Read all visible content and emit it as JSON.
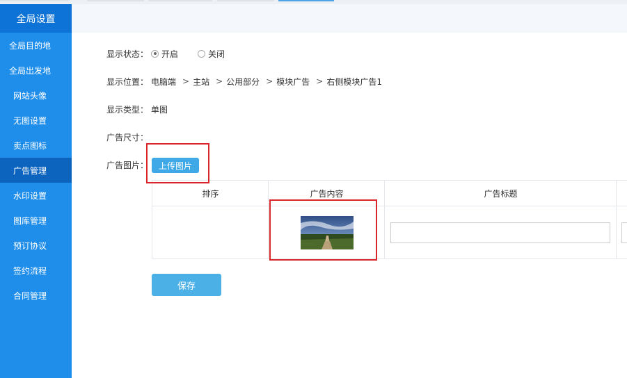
{
  "sidebar": {
    "header": "全局设置",
    "items": [
      {
        "label": "全局目的地"
      },
      {
        "label": "全局出发地"
      },
      {
        "label": "网站头像"
      },
      {
        "label": "无图设置"
      },
      {
        "label": "卖点图标"
      },
      {
        "label": "广告管理"
      },
      {
        "label": "水印设置"
      },
      {
        "label": "图库管理"
      },
      {
        "label": "预订协议"
      },
      {
        "label": "签约流程"
      },
      {
        "label": "合同管理"
      }
    ],
    "active_index": 5
  },
  "form": {
    "status_label": "显示状态：",
    "status_options": [
      "开启",
      "关闭"
    ],
    "status_selected": "开启",
    "position_label": "显示位置：",
    "position_path": [
      "电脑端",
      "主站",
      "公用部分",
      "模块广告",
      "右侧模块广告1"
    ],
    "position_sep": ">",
    "type_label": "显示类型：",
    "type_value": "单图",
    "size_label": "广告尺寸：",
    "image_label": "广告图片：",
    "upload_label": "上传图片"
  },
  "table": {
    "headers": [
      "排序",
      "广告内容",
      "广告标题"
    ]
  },
  "save_label": "保存",
  "colors": {
    "sidebar": "#1f8eeb",
    "sidebar_active": "#0d64bf",
    "button": "#3fa9e8",
    "highlight": "#d9262b"
  }
}
